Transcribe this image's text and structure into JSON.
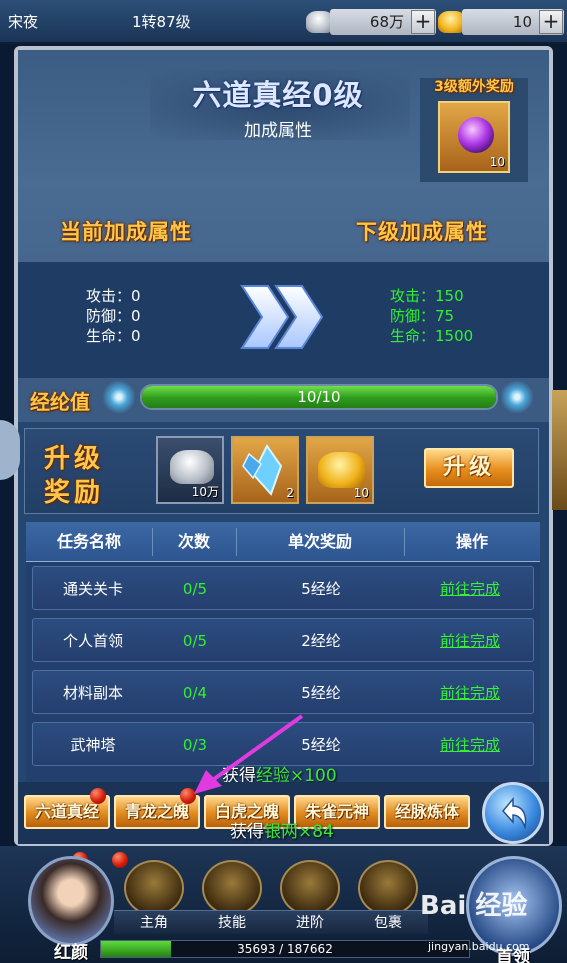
{
  "topbar": {
    "player_name": "宋夜",
    "rebirth_level": "1转87级",
    "silver": "68万",
    "gold": "10",
    "plus": "+"
  },
  "panel": {
    "title": "六道真经0级",
    "subtitle": "加成属性",
    "extra_reward_label": "3级额外奖励",
    "extra_reward_count": "10",
    "current_label": "当前加成属性",
    "next_label": "下级加成属性",
    "current_stats": [
      "攻击：0",
      "防御：0",
      "生命：0"
    ],
    "next_stats": [
      "攻击：150",
      "防御：75",
      "生命：1500"
    ],
    "exp_label": "经纶值",
    "exp_text": "10/10",
    "exp_progress": 1.0,
    "upgrade_reward_label_1": "升级",
    "upgrade_reward_label_2": "奖励",
    "rewards": [
      {
        "icon": "silver-ingot-icon",
        "count": "10万"
      },
      {
        "icon": "blue-crystal-icon",
        "count": "2"
      },
      {
        "icon": "gold-ingot-icon",
        "count": "10"
      }
    ],
    "upgrade_button": "升级"
  },
  "table": {
    "headers": [
      "任务名称",
      "次数",
      "单次奖励",
      "操作"
    ],
    "rows": [
      {
        "name": "通关关卡",
        "count": "0/5",
        "reward": "5经纶",
        "action": "前往完成"
      },
      {
        "name": "个人首领",
        "count": "0/5",
        "reward": "2经纶",
        "action": "前往完成"
      },
      {
        "name": "材料副本",
        "count": "0/4",
        "reward": "5经纶",
        "action": "前往完成"
      },
      {
        "name": "武神塔",
        "count": "0/3",
        "reward": "5经纶",
        "action": "前往完成"
      }
    ]
  },
  "toasts": {
    "exp_prefix": "获得",
    "exp_text": "经验×100",
    "silver_prefix": "获得",
    "silver_text": "银两×84"
  },
  "tabs": [
    "六道真经",
    "青龙之魄",
    "白虎之魄",
    "朱雀元神",
    "经脉炼体"
  ],
  "nav": {
    "avatar_label": "红颜",
    "items": [
      "主角",
      "技能",
      "进阶",
      "包裹"
    ],
    "boss_label": "首领",
    "hp_text": "35693 / 187662",
    "hp_progress": 0.19
  },
  "watermark": {
    "text": "Bai 经验",
    "url": "jingyan.baidu.com"
  },
  "colors": {
    "gold_text": "#ffc64a",
    "green_text": "#32f032",
    "accent_arrow": "#e03be0"
  }
}
